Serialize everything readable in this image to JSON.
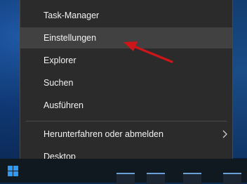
{
  "menu": {
    "items": [
      {
        "label": "Task-Manager"
      },
      {
        "label": "Einstellungen"
      },
      {
        "label": "Explorer"
      },
      {
        "label": "Suchen"
      },
      {
        "label": "Ausführen"
      },
      {
        "label": "Herunterfahren oder abmelden"
      },
      {
        "label": "Desktop"
      }
    ],
    "highlighted_item": "Einstellungen"
  },
  "colors": {
    "menu_background": "#2b2b2b",
    "menu_highlight": "#414141",
    "annotation_arrow": "#d01418",
    "windows_logo": "#2e9af5"
  },
  "icons": [
    "chevron-right-icon",
    "windows-logo-icon",
    "red-arrow-annotation"
  ]
}
